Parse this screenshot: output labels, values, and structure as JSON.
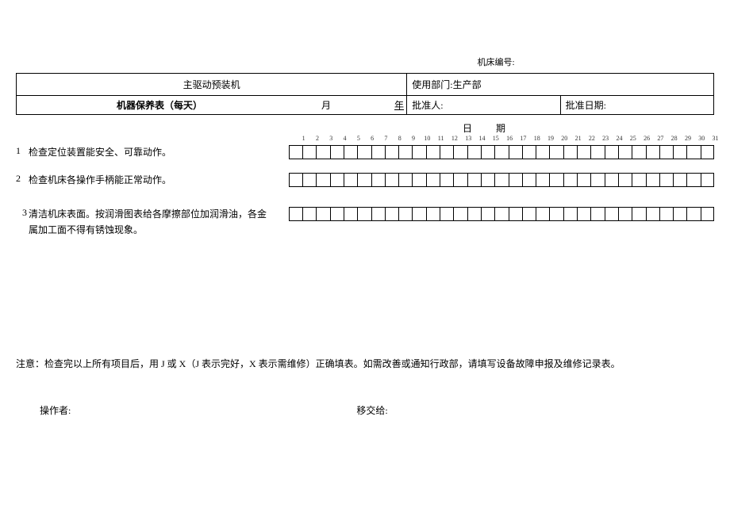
{
  "header": {
    "machine_id_label": "机床编号:",
    "title": "主驱动预装机",
    "dept_label": "使用部门:",
    "dept_value": "生产部",
    "maint_label": "机器保养表（每天）",
    "month_label": "月",
    "year_label": "年",
    "approver_label": "批准人:",
    "approve_date_label": "批准日期:"
  },
  "date_heading": "日期",
  "days": [
    "1",
    "2",
    "3",
    "4",
    "5",
    "6",
    "7",
    "8",
    "9",
    "10",
    "11",
    "12",
    "13",
    "14",
    "15",
    "16",
    "17",
    "18",
    "19",
    "20",
    "21",
    "22",
    "23",
    "24",
    "25",
    "26",
    "27",
    "28",
    "29",
    "30",
    "31"
  ],
  "items": [
    {
      "num": "1",
      "text": "检查定位装置能安全、可靠动作。"
    },
    {
      "num": "2",
      "text": "检查机床各操作手柄能正常动作。"
    },
    {
      "num": "3",
      "text": "清洁机床表面。按润滑图表给各摩擦部位加润滑油，各金属加工面不得有锈蚀现象。"
    }
  ],
  "note": "注意：检查完以上所有项目后，用 J 或 X（J 表示完好，X 表示需维修）正确填表。如需改善或通知行政部，请填写设备故障申报及维修记录表。",
  "signatures": {
    "operator_label": "操作者:",
    "handover_label": "移交给:"
  }
}
